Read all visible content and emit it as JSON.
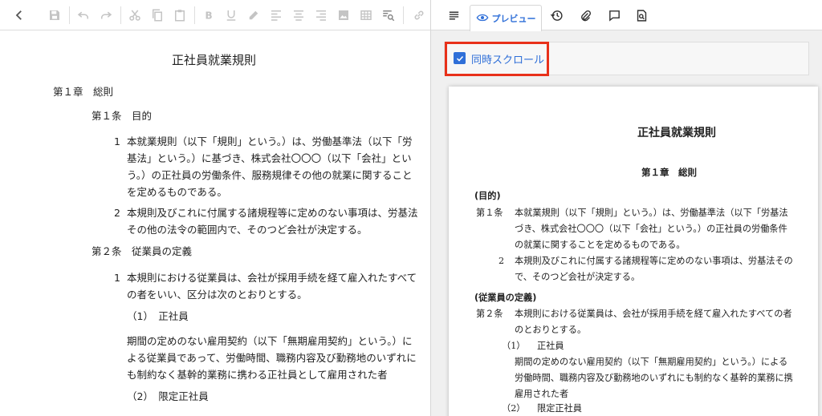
{
  "editor": {
    "toolbar": {
      "icons": [
        "back-icon",
        "save-icon",
        "undo-icon",
        "redo-icon",
        "cut-icon",
        "copy-icon",
        "paste-icon",
        "bold-icon",
        "underline-icon",
        "highlight-icon",
        "align-left-icon",
        "align-center-icon",
        "align-right-icon",
        "image-icon",
        "table-icon",
        "find-replace-icon",
        "link-icon"
      ]
    },
    "title": "正社員就業規則",
    "chapter1": "第１章　総則",
    "article1": "第１条　目的",
    "a1_p1_num": "1",
    "a1_p1_lines": [
      "本就業規則（以下「規則」という。）は、労働基準法（以下「労",
      "基法」という。）に基づき、株式会社〇〇〇（以下「会社」とい",
      "う。）の正社員の労働条件、服務規律その他の就業に関すること",
      "を定めるものである。"
    ],
    "a1_p2_num": "2",
    "a1_p2_lines": [
      "本規則及びこれに付属する諸規程等に定めのない事項は、労基法",
      "その他の法令の範囲内で、そのつど会社が決定する。"
    ],
    "article2": "第２条　従業員の定義",
    "a2_p1_num": "1",
    "a2_p1_lines": [
      "本規則における従業員は、会社が採用手続を経て雇入れたすべて",
      "の者をいい、区分は次のとおりとする。"
    ],
    "item1": "（1）　正社員",
    "item1_lines": [
      "期間の定めのない雇用契約（以下「無期雇用契約」という。）に",
      "よる従業員であって、労働時間、職務内容及び勤務地のいずれに",
      "も制約なく基幹的業務に携わる正社員として雇用された者"
    ],
    "item2": "（2）　限定正社員"
  },
  "preview": {
    "tab_label": "プレビュー",
    "tab_icons": [
      "outline-icon",
      "eye-icon",
      "history-icon",
      "attachment-icon",
      "comment-icon",
      "find-in-document-icon"
    ],
    "sync_scroll": {
      "label": "同時スクロール",
      "checked": true
    },
    "doc": {
      "title": "正社員就業規則",
      "chapter1": "第１章　総則",
      "head1": "(目的)",
      "art1_label": "第１条",
      "art1_lines": [
        "本就業規則（以下「規則」という。）は、労働基準法（以下「労基法",
        "づき、株式会社〇〇〇（以下「会社」という。）の正社員の労働条件",
        "の就業に関することを定めるものである。"
      ],
      "art1_p2_num": "2",
      "art1_p2_lines": [
        "本規則及びこれに付属する諸規程等に定めのない事項は、労基法その",
        "で、そのつど会社が決定する。"
      ],
      "head2": "(従業員の定義)",
      "art2_label": "第２条",
      "art2_lines": [
        "本規則における従業員は、会社が採用手続を経て雇入れたすべての者",
        "のとおりとする。"
      ],
      "item1_num": "（1）",
      "item1_title": "正社員",
      "item1_lines": [
        "期間の定めのない雇用契約（以下「無期雇用契約」という。）による",
        "労働時間、職務内容及び勤務地のいずれにも制約なく基幹的業務に携",
        "雇用された者"
      ],
      "item2_num": "（2）",
      "item2_title": "限定正社員"
    }
  },
  "colors": {
    "accent": "#2f6fd8",
    "highlight": "#e8311a",
    "icon": "#bdbdbd"
  }
}
